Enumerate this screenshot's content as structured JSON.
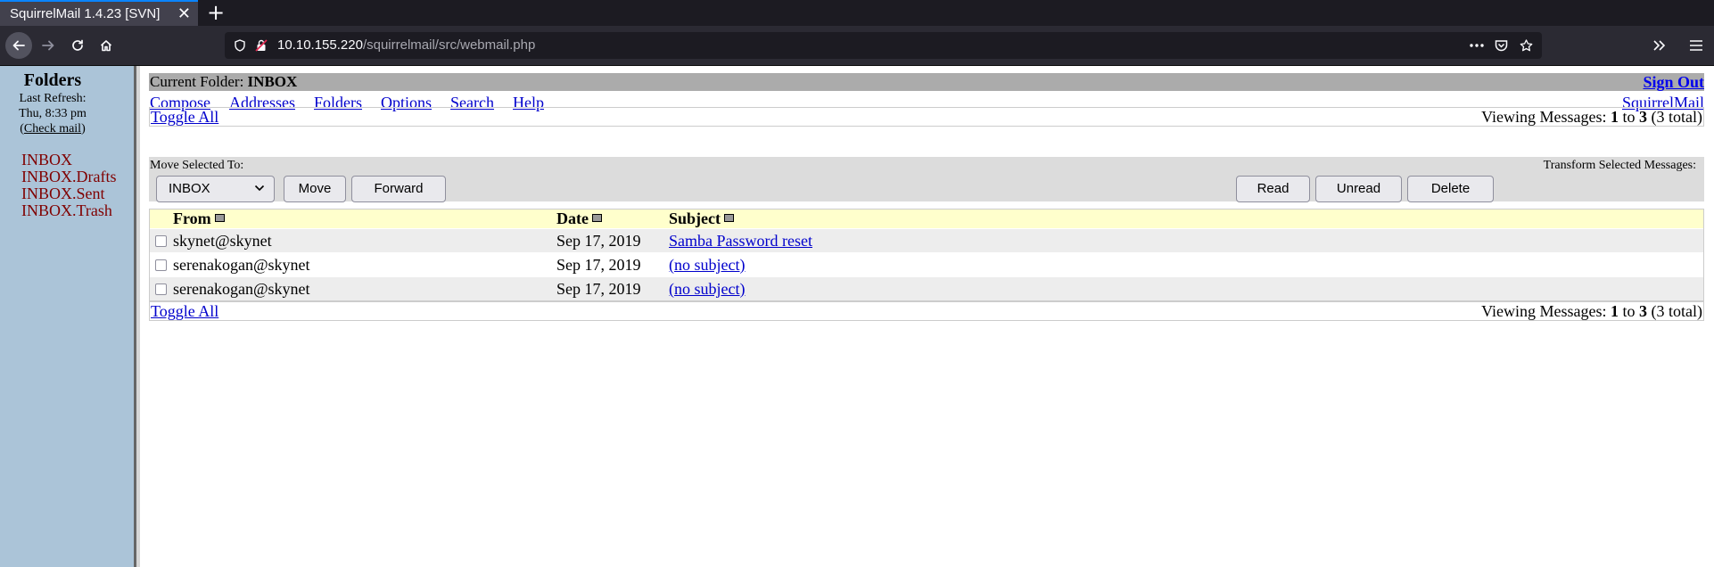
{
  "browser": {
    "tab_title": "SquirrelMail 1.4.23 [SVN]",
    "tab_close": "✕",
    "new_tab": "+",
    "url_host": "10.10.155.220",
    "url_path": "/squirrelmail/src/webmail.php",
    "accent": "#0a84ff"
  },
  "sidebar": {
    "title": "Folders",
    "last_refresh_label": "Last  Refresh:",
    "last_refresh_time": "Thu,  8:33  pm",
    "check_open": "(",
    "check_mail": "Check mail",
    "check_close": ")",
    "folders": [
      {
        "label": "INBOX"
      },
      {
        "label": "INBOX.Drafts"
      },
      {
        "label": "INBOX.Sent"
      },
      {
        "label": "INBOX.Trash"
      }
    ]
  },
  "header": {
    "current_folder_label": "Current Folder:",
    "current_folder": "INBOX",
    "sign_out": "Sign Out",
    "squirrelmail": "SquirrelMail",
    "menu": [
      {
        "label": "Compose"
      },
      {
        "label": "Addresses"
      },
      {
        "label": "Folders"
      },
      {
        "label": "Options"
      },
      {
        "label": "Search"
      },
      {
        "label": "Help"
      }
    ]
  },
  "paging": {
    "toggle_all": "Toggle All",
    "viewing_prefix": "Viewing Messages:",
    "first": "1",
    "to": "to",
    "last": "3",
    "total": "(3 total)"
  },
  "actions": {
    "move_label": "Move Selected To:",
    "move_target": "INBOX",
    "move_button": "Move",
    "forward_button": "Forward",
    "transform_label": "Transform Selected Messages:",
    "read_button": "Read",
    "unread_button": "Unread",
    "delete_button": "Delete"
  },
  "table": {
    "columns": {
      "from": "From",
      "date": "Date",
      "subject": "Subject"
    },
    "rows": [
      {
        "from": "skynet@skynet",
        "date": "Sep 17, 2019",
        "subject": "Samba Password reset"
      },
      {
        "from": "serenakogan@skynet",
        "date": "Sep 17, 2019",
        "subject": "(no subject)"
      },
      {
        "from": "serenakogan@skynet",
        "date": "Sep 17, 2019",
        "subject": "(no subject)"
      }
    ]
  }
}
